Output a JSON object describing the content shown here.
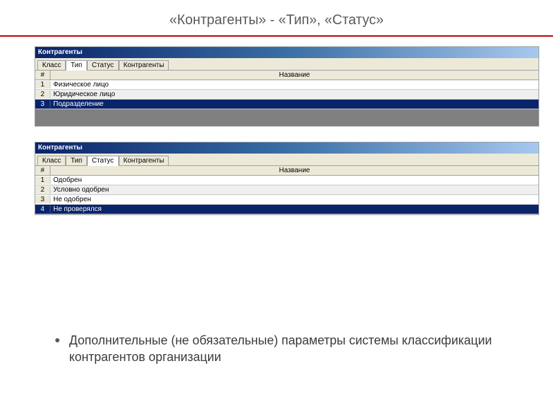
{
  "slide": {
    "title": "«Контрагенты» - «Тип», «Статус»"
  },
  "panel1": {
    "title": "Контрагенты",
    "tabs": [
      "Класс",
      "Тип",
      "Статус",
      "Контрагенты"
    ],
    "activeTab": 1,
    "columns": {
      "num": "#",
      "name": "Название"
    },
    "rows": [
      {
        "n": "1",
        "name": "Физическое лицо",
        "selected": false
      },
      {
        "n": "2",
        "name": "Юридическое лицо",
        "selected": false
      },
      {
        "n": "3",
        "name": "Подразделение",
        "selected": true
      }
    ]
  },
  "panel2": {
    "title": "Контрагенты",
    "tabs": [
      "Класс",
      "Тип",
      "Статус",
      "Контрагенты"
    ],
    "activeTab": 2,
    "columns": {
      "num": "#",
      "name": "Название"
    },
    "rows": [
      {
        "n": "1",
        "name": "Одобрен",
        "selected": false
      },
      {
        "n": "2",
        "name": "Условно одобрен",
        "selected": false
      },
      {
        "n": "3",
        "name": "Не одобрен",
        "selected": false
      },
      {
        "n": "4",
        "name": "Не проверялся",
        "selected": true
      }
    ]
  },
  "bullet": {
    "text": "Дополнительные (не обязательные) параметры системы классификации контрагентов организации"
  }
}
